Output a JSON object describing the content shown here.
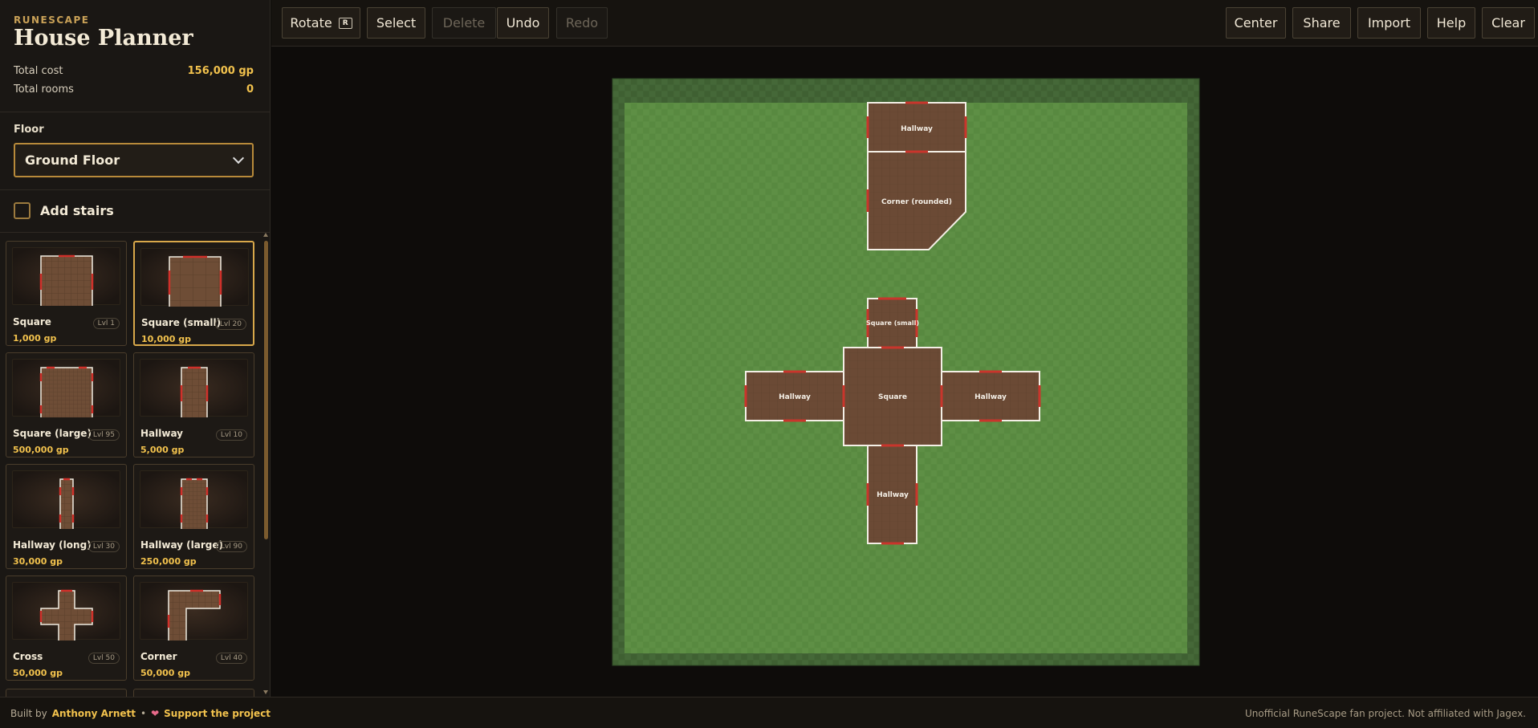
{
  "brand": "RUNESCAPE",
  "title": "House Planner",
  "stats": {
    "total_cost_label": "Total cost",
    "total_cost_value": "156,000 gp",
    "total_rooms_label": "Total rooms",
    "total_rooms_value": "0"
  },
  "floor": {
    "label": "Floor",
    "selected": "Ground Floor"
  },
  "stairs": {
    "label": "Add stairs",
    "checked": false
  },
  "rooms": [
    {
      "name": "Square",
      "level": "Lvl 1",
      "cost": "1,000 gp",
      "selected": false
    },
    {
      "name": "Square (small)",
      "level": "Lvl 20",
      "cost": "10,000 gp",
      "selected": true
    },
    {
      "name": "Square (large)",
      "level": "Lvl 95",
      "cost": "500,000 gp",
      "selected": false
    },
    {
      "name": "Hallway",
      "level": "Lvl 10",
      "cost": "5,000 gp",
      "selected": false
    },
    {
      "name": "Hallway (long)",
      "level": "Lvl 30",
      "cost": "30,000 gp",
      "selected": false
    },
    {
      "name": "Hallway (large)",
      "level": "Lvl 90",
      "cost": "250,000 gp",
      "selected": false
    },
    {
      "name": "Cross",
      "level": "Lvl 50",
      "cost": "50,000 gp",
      "selected": false
    },
    {
      "name": "Corner",
      "level": "Lvl 40",
      "cost": "50,000 gp",
      "selected": false
    }
  ],
  "toolbar": {
    "rotate": "Rotate",
    "rotate_key": "R",
    "select": "Select",
    "delete": "Delete",
    "undo": "Undo",
    "redo": "Redo",
    "center": "Center",
    "share": "Share",
    "import": "Import",
    "help": "Help",
    "clear": "Clear"
  },
  "placed_rooms": {
    "hallway_top": "Hallway",
    "corner_rounded": "Corner (rounded)",
    "square_small": "Square (small)",
    "square": "Square",
    "hallway_left": "Hallway",
    "hallway_right": "Hallway",
    "hallway_bottom": "Hallway"
  },
  "footer": {
    "built_by": "Built by",
    "author": "Anthony Arnett",
    "separator": "•",
    "support": "Support the project",
    "disclaimer": "Unofficial RuneScape fan project. Not affiliated with Jagex."
  },
  "colors": {
    "accent": "#f2c24d",
    "grass": "#5b8a42",
    "room_floor": "#6b4a35",
    "door": "#c0392b"
  }
}
